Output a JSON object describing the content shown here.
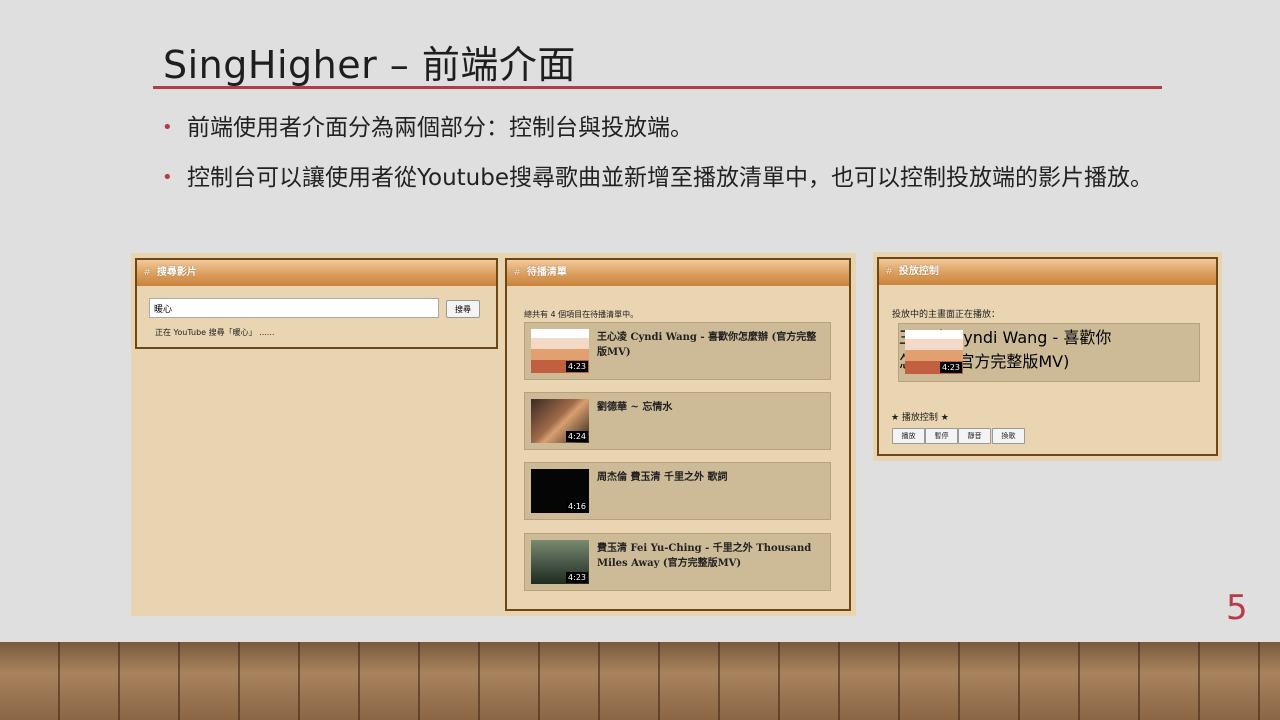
{
  "slide": {
    "title": "SingHigher – 前端介面",
    "bullets": [
      "前端使用者介面分為兩個部分：控制台與投放端。",
      "控制台可以讓使用者從Youtube搜尋歌曲並新增至播放清單中，也可以控制投放端的影片播放。"
    ],
    "page_number": "5"
  },
  "search_panel": {
    "title": "搜尋影片",
    "query": "暖心",
    "button_label": "搜尋",
    "status": "正在 YouTube 搜尋「暖心」 ......"
  },
  "queue_panel": {
    "title": "待播清單",
    "summary": "總共有 4 個項目在待播清單中。",
    "items": [
      {
        "title": "王心凌 Cyndi Wang - 喜歡你怎麼辦 (官方完整版MV)",
        "duration": "4:23"
      },
      {
        "title": "劉德華 ~ 忘情水",
        "duration": "4:24"
      },
      {
        "title": "周杰倫 費玉清 千里之外 歌詞",
        "duration": "4:16"
      },
      {
        "title": "費玉清 Fei Yu-Ching - 千里之外 Thousand Miles Away (官方完整版MV)",
        "duration": "4:23"
      }
    ]
  },
  "control_panel": {
    "title": "投放控制",
    "now_playing_label": "投放中的主畫面正在播放：",
    "now_playing": {
      "title": "王心凌 Cyndi Wang - 喜歡你怎麼辦 (官方完整版MV)",
      "duration": "4:23"
    },
    "controls_heading": "★ 播放控制 ★",
    "buttons": [
      "播放",
      "暫停",
      "靜音",
      "換歌"
    ]
  },
  "colors": {
    "accent": "#b83a46",
    "panel_border": "#6d4716",
    "panel_bg": "#e9d5b1",
    "item_bg": "#cdbb98"
  }
}
